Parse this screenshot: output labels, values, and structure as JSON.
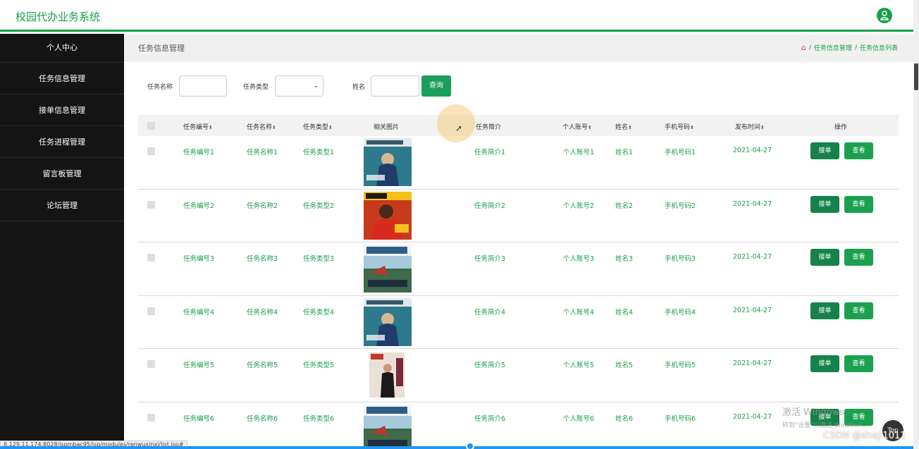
{
  "app_title": "校园代办业务系统",
  "sidebar": {
    "items": [
      {
        "label": "个人中心"
      },
      {
        "label": "任务信息管理"
      },
      {
        "label": "接单信息管理"
      },
      {
        "label": "任务进程管理"
      },
      {
        "label": "留言板管理"
      },
      {
        "label": "论坛管理"
      }
    ]
  },
  "page_header": {
    "title": "任务信息管理",
    "breadcrumb": [
      "任务信息管理",
      "任务信息列表"
    ]
  },
  "search": {
    "task_name_label": "任务名称",
    "task_name_value": "",
    "task_type_label": "任务类型",
    "task_type_value": "",
    "person_name_label": "姓名",
    "person_name_value": "",
    "query_button": "查询"
  },
  "table": {
    "columns": [
      "任务编号",
      "任务名称",
      "任务类型",
      "相关图片",
      "任务简介",
      "个人账号",
      "姓名",
      "手机号码",
      "发布时间",
      "操作"
    ],
    "sort_icon": "⬍",
    "rows": [
      {
        "id": "任务编号1",
        "name": "任务名称1",
        "type": "任务类型1",
        "image": "magazine-marie-claire",
        "intro": "任务简介1",
        "account": "个人账号1",
        "person": "姓名1",
        "phone": "手机号码1",
        "date": "2021-04-27"
      },
      {
        "id": "任务编号2",
        "name": "任务名称2",
        "type": "任务类型2",
        "image": "magazine-soccer",
        "intro": "任务简介2",
        "account": "个人账号2",
        "person": "姓名2",
        "phone": "手机号码2",
        "date": "2021-04-27"
      },
      {
        "id": "任务编号3",
        "name": "任务名称3",
        "type": "任务类型3",
        "image": "magazine-voyage",
        "intro": "任务简介3",
        "account": "个人账号3",
        "person": "姓名3",
        "phone": "手机号码3",
        "date": "2021-04-27"
      },
      {
        "id": "任务编号4",
        "name": "任务名称4",
        "type": "任务类型4",
        "image": "magazine-marie-claire",
        "intro": "任务简介4",
        "account": "个人账号4",
        "person": "姓名4",
        "phone": "手机号码4",
        "date": "2021-04-27"
      },
      {
        "id": "任务编号5",
        "name": "任务名称5",
        "type": "任务类型5",
        "image": "magazine-fashion",
        "intro": "任务简介5",
        "account": "个人账号5",
        "person": "姓名5",
        "phone": "手机号码5",
        "date": "2021-04-27"
      },
      {
        "id": "任务编号6",
        "name": "任务名称6",
        "type": "任务类型6",
        "image": "magazine-voyage",
        "intro": "任务简介6",
        "account": "个人账号6",
        "person": "姓名6",
        "phone": "手机号码6",
        "date": "2021-04-27"
      }
    ],
    "take_button": "接单",
    "view_button": "查看"
  },
  "status_url": "8.129.11.174:8028/jspmbac95/jsp/modules/renwuxinxi/list.jsp#",
  "watermark": {
    "line1": "激活 Windows",
    "line2": "转到\"设置\"以激活 Windows。"
  },
  "top_button": "Top",
  "csdn": "CSDN @sheji1011",
  "colors": {
    "accent": "#1a9e4a",
    "sidebar_bg": "#141414",
    "button": "#14824a"
  }
}
